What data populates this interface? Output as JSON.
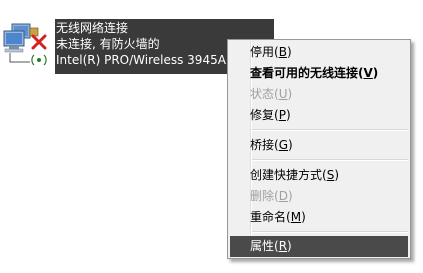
{
  "connection": {
    "name": "无线网络连接",
    "status": "未连接, 有防火墙的",
    "device": "Intel(R) PRO/Wireless 3945AB"
  },
  "menu": {
    "items": [
      {
        "label": "停用",
        "key": "B",
        "bold": false,
        "disabled": false,
        "selected": false
      },
      {
        "label": "查看可用的无线连接",
        "key": "V",
        "bold": true,
        "disabled": false,
        "selected": false
      },
      {
        "label": "状态",
        "key": "U",
        "bold": false,
        "disabled": true,
        "selected": false
      },
      {
        "label": "修复",
        "key": "P",
        "bold": false,
        "disabled": false,
        "selected": false
      },
      {
        "label": "桥接",
        "key": "G",
        "bold": false,
        "disabled": false,
        "selected": false
      },
      {
        "label": "创建快捷方式",
        "key": "S",
        "bold": false,
        "disabled": false,
        "selected": false
      },
      {
        "label": "删除",
        "key": "D",
        "bold": false,
        "disabled": true,
        "selected": false
      },
      {
        "label": "重命名",
        "key": "M",
        "bold": false,
        "disabled": false,
        "selected": false
      },
      {
        "label": "属性",
        "key": "R",
        "bold": false,
        "disabled": false,
        "selected": true
      }
    ]
  },
  "colors": {
    "highlight": "#3a3a3a",
    "menu_bg": "#f0f0f0",
    "disabled_text": "#a0a0a0",
    "error_x": "#d42020"
  }
}
